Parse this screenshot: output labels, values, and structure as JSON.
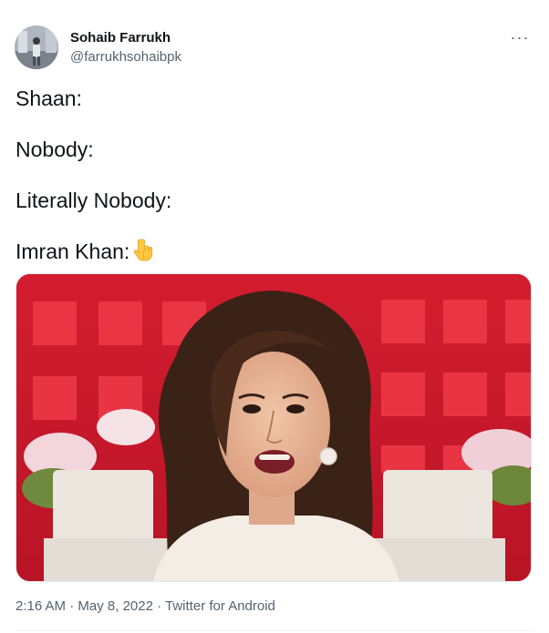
{
  "author": {
    "name": "Sohaib Farrukh",
    "handle": "@farrukhsohaibpk"
  },
  "menu": {
    "more_label": "···",
    "more_icon": "more-horizontal-icon"
  },
  "body_lines": [
    "Shaan:",
    "Nobody:",
    "Literally Nobody:",
    "Imran Khan:"
  ],
  "emoji_icon": "backhand-index-pointing-down-icon",
  "meta": {
    "time": "2:16 AM",
    "separator": " · ",
    "date": "May 8, 2022",
    "source": "Twitter for Android"
  },
  "colors": {
    "text": "#0f1419",
    "secondary": "#536471",
    "media_background": "#cf1c2d"
  }
}
